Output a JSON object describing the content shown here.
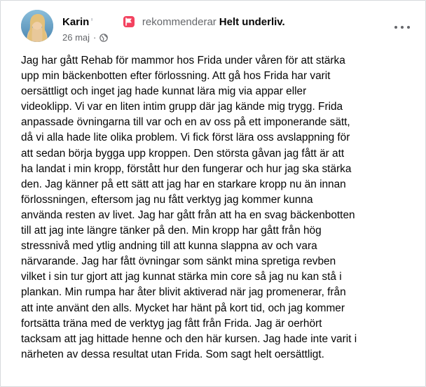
{
  "post": {
    "author": "Karin",
    "author_fade": "'",
    "recommends_text": "rekommenderar",
    "page_name": "Helt underliv.",
    "date": "26 maj",
    "dot": "·",
    "icons": {
      "recommend": "recommend-flag-icon",
      "privacy": "globe-icon",
      "menu": "more-options-icon"
    },
    "colors": {
      "recommend_icon": "#f3425f",
      "secondary_text": "#65676b"
    },
    "lines": [
      "Jag har gått Rehab för mammor hos Frida under våren för att stärka",
      "upp min bäckenbotten efter förlossning. Att gå hos Frida har varit",
      "oersättligt och inget jag hade kunnat lära mig via appar eller",
      "videoklipp. Vi var en liten intim grupp där jag kände mig trygg. Frida",
      "anpassade övningarna till var och en av oss på ett imponerande sätt,",
      "då vi alla hade lite olika problem.  Vi fick först lära oss avslappning för",
      "att sedan börja bygga upp kroppen. Den största gåvan jag fått är att",
      "ha landat i min kropp, förstått hur den fungerar och hur jag ska stärka",
      "den. Jag känner på ett sätt att jag har en starkare kropp nu än innan",
      "förlossningen, eftersom jag nu fått verktyg jag kommer kunna",
      "använda resten av livet. Jag har gått från att ha en svag bäckenbotten",
      "till att jag inte längre tänker på den. Min kropp har gått från hög",
      "stressnivå med ytlig andning till att kunna slappna av och vara",
      "närvarande. Jag har fått övningar som sänkt mina spretiga revben",
      "vilket i sin tur gjort att jag kunnat stärka min core så jag nu kan stå i",
      "plankan. Min rumpa har åter blivit aktiverad när jag promenerar, från",
      "att inte använt den alls.  Mycket har hänt på kort tid, och jag kommer",
      "fortsätta träna med de verktyg jag fått från Frida. Jag är oerhört",
      "tacksam att jag hittade henne och den här kursen. Jag hade inte varit i",
      "närheten av dessa resultat utan Frida. Som sagt helt oersättligt."
    ]
  }
}
